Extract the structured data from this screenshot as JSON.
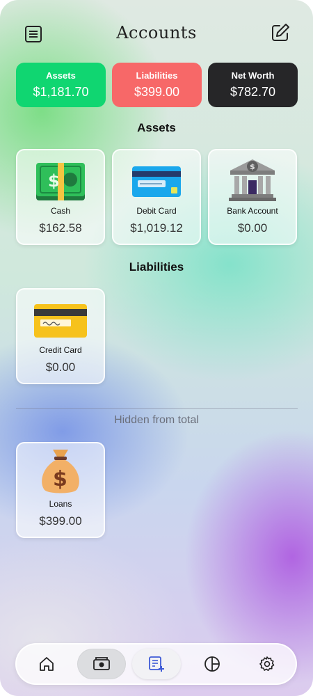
{
  "header": {
    "title": "Accounts"
  },
  "summary": {
    "assets": {
      "label": "Assets",
      "value": "$1,181.70",
      "color": "#10d671"
    },
    "liabilities": {
      "label": "Liabilities",
      "value": "$399.00",
      "color": "#f76868"
    },
    "net_worth": {
      "label": "Net Worth",
      "value": "$782.70",
      "color": "#262628"
    }
  },
  "sections": {
    "assets": {
      "title": "Assets",
      "items": [
        {
          "name": "Cash",
          "amount": "$162.58",
          "icon": "cash-icon"
        },
        {
          "name": "Debit Card",
          "amount": "$1,019.12",
          "icon": "debit-card-icon"
        },
        {
          "name": "Bank Account",
          "amount": "$0.00",
          "icon": "bank-icon"
        }
      ]
    },
    "liabilities": {
      "title": "Liabilities",
      "items": [
        {
          "name": "Credit Card",
          "amount": "$0.00",
          "icon": "credit-card-icon"
        }
      ]
    },
    "hidden": {
      "title": "Hidden from total",
      "items": [
        {
          "name": "Loans",
          "amount": "$399.00",
          "icon": "money-bag-icon"
        }
      ]
    }
  },
  "nav": {
    "items": [
      {
        "icon": "home-icon",
        "state": "default"
      },
      {
        "icon": "wallet-icon",
        "state": "active"
      },
      {
        "icon": "add-record-icon",
        "state": "add"
      },
      {
        "icon": "pie-chart-icon",
        "state": "default"
      },
      {
        "icon": "gear-icon",
        "state": "default"
      }
    ]
  }
}
